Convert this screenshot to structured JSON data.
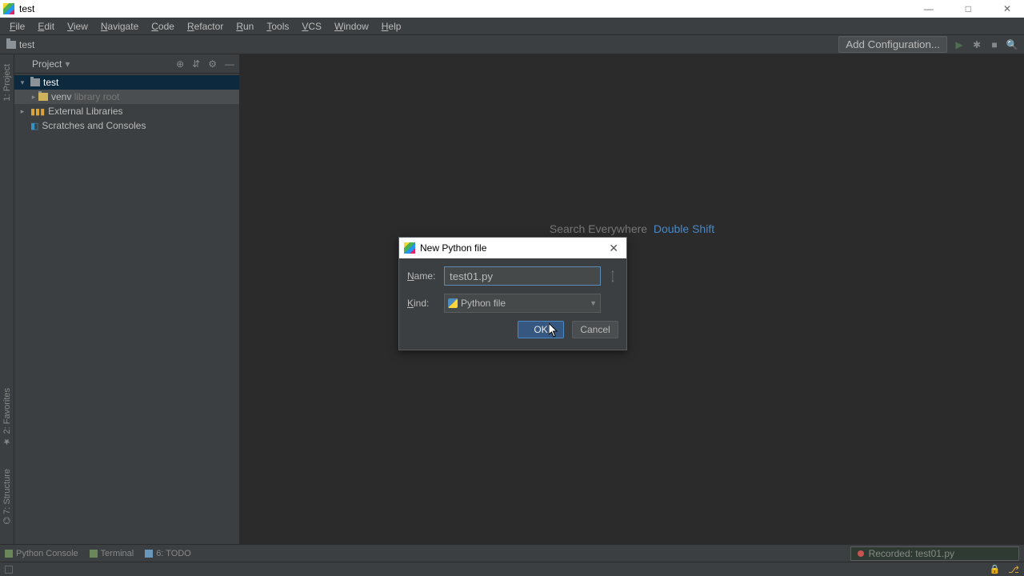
{
  "window": {
    "title": "test"
  },
  "menubar": [
    "File",
    "Edit",
    "View",
    "Navigate",
    "Code",
    "Refactor",
    "Run",
    "Tools",
    "VCS",
    "Window",
    "Help"
  ],
  "navbar": {
    "breadcrumb": "test",
    "add_config": "Add Configuration..."
  },
  "project": {
    "title": "Project",
    "tree": {
      "root": "test",
      "venv": "venv",
      "venv_hint": "library root",
      "external": "External Libraries",
      "scratches": "Scratches and Consoles"
    }
  },
  "left_tabs": [
    "1: Project",
    "Favorites",
    "7: Structure"
  ],
  "hints": {
    "search": "Search Everywhere",
    "shortcut": "Double Shift"
  },
  "dialog": {
    "title": "New Python file",
    "name_label": "Name:",
    "name_value": "test01.py",
    "kind_label": "Kind:",
    "kind_value": "Python file",
    "ok": "OK",
    "cancel": "Cancel"
  },
  "bottom": {
    "python_console": "Python Console",
    "terminal": "Terminal",
    "todo": "6: TODO",
    "recorded": "Recorded: test01.py"
  }
}
